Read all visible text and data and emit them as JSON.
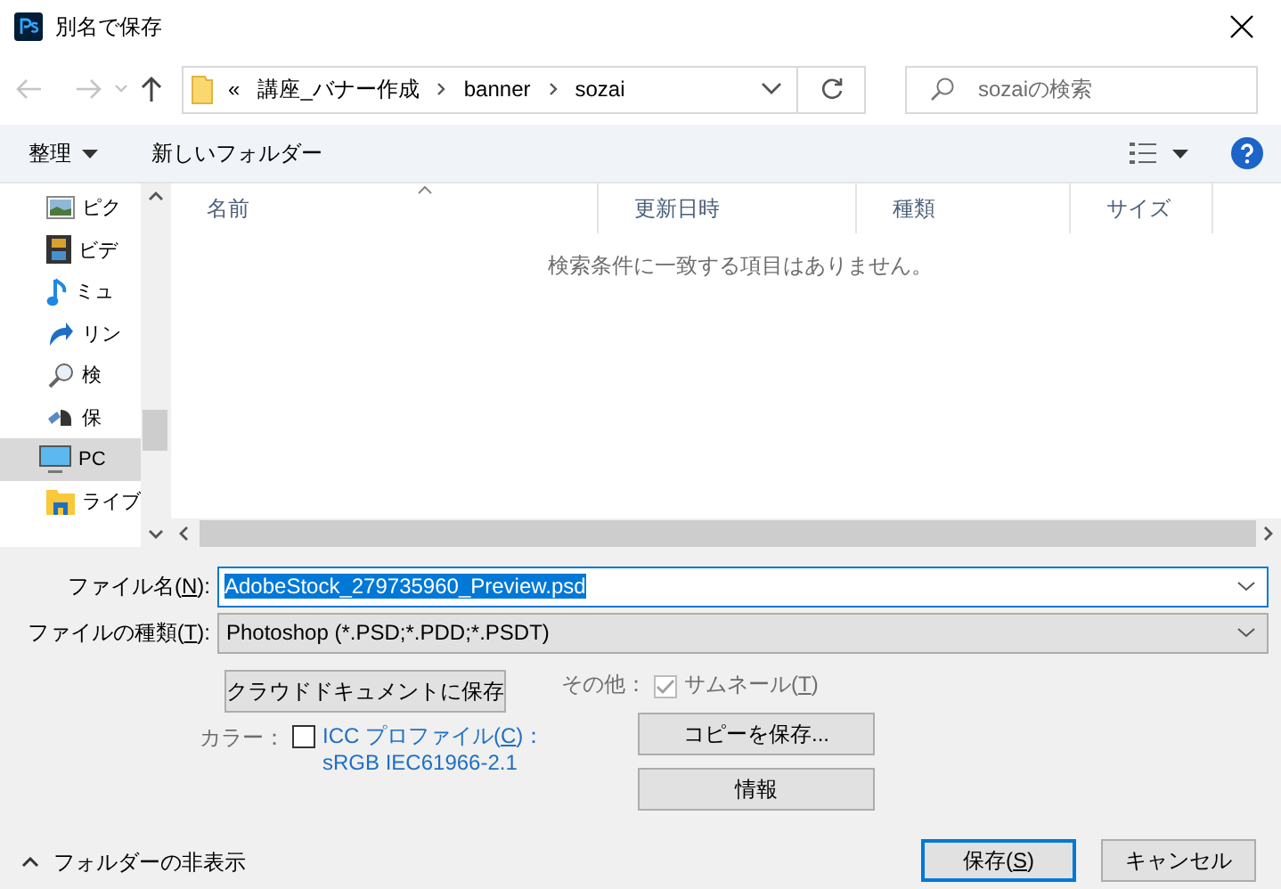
{
  "window": {
    "title": "別名で保存"
  },
  "address": {
    "overflow": "«",
    "path": [
      "講座_バナー作成",
      "banner",
      "sozai"
    ]
  },
  "search": {
    "placeholder": "sozaiの検索"
  },
  "toolbar": {
    "organize": "整理",
    "new_folder": "新しいフォルダー"
  },
  "sidebar": {
    "items": [
      {
        "label": "ピク",
        "kind": "pictures",
        "selected": false
      },
      {
        "label": "ビデ",
        "kind": "videos",
        "selected": false
      },
      {
        "label": "ミュ",
        "kind": "music",
        "selected": false
      },
      {
        "label": "リン",
        "kind": "links",
        "selected": false
      },
      {
        "label": "検",
        "kind": "searches",
        "selected": false
      },
      {
        "label": "保",
        "kind": "games",
        "selected": false
      },
      {
        "label": "PC",
        "kind": "pc",
        "selected": true
      },
      {
        "label": "ライブ",
        "kind": "libraries",
        "selected": false
      }
    ]
  },
  "table": {
    "columns": [
      "名前",
      "更新日時",
      "種類",
      "サイズ"
    ],
    "empty_message": "検索条件に一致する項目はありません。"
  },
  "form": {
    "file_name": {
      "label": {
        "before": "ファイル名(",
        "key": "N",
        "after": "):"
      },
      "value": "AdobeStock_279735960_Preview.psd",
      "selected": true
    },
    "file_type": {
      "label": {
        "before": "ファイルの種類(",
        "key": "T",
        "after": "):"
      },
      "value": "Photoshop (*.PSD;*.PDD;*.PSDT)"
    },
    "cloud_button": "クラウドドキュメントに保存",
    "other": {
      "label": "その他：",
      "thumbnail": {
        "label": {
          "before": "サムネール(",
          "key": "T",
          "after": ")"
        },
        "checked": true,
        "disabled": true
      }
    },
    "color": {
      "label": "カラー：",
      "icc": {
        "label": {
          "before": "ICC プロファイル(",
          "key": "C",
          "after": ")："
        },
        "profile": "sRGB IEC61966-2.1",
        "checked": false
      }
    },
    "copy_button": "コピーを保存...",
    "info_button": "情報"
  },
  "footer": {
    "hide_folders": "フォルダーの非表示",
    "buttons": [
      {
        "label": {
          "before": "保存(",
          "key": "S",
          "after": ")"
        },
        "default": true
      },
      {
        "label": {
          "before": "キャンセル"
        },
        "default": false
      }
    ]
  }
}
